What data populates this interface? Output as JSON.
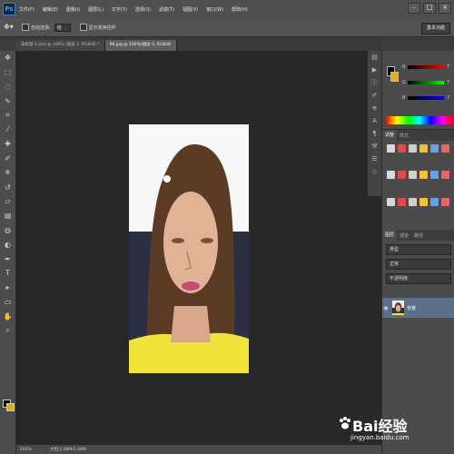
{
  "app": {
    "logo": "Ps"
  },
  "menu": [
    "文件(F)",
    "编辑(E)",
    "图像(I)",
    "图层(L)",
    "文字(Y)",
    "选择(S)",
    "滤镜(T)",
    "视图(V)",
    "窗口(W)",
    "帮助(H)"
  ],
  "window_controls": [
    "–",
    "□",
    "×"
  ],
  "options": {
    "auto_select_label": "自动选择:",
    "auto_select_value": "组",
    "transform_label": "显示变换控件"
  },
  "workspace_button": "基本功能",
  "tabs": [
    {
      "label": "未标题-1.psd @ 100% (图层 2, RGB/8) *",
      "active": false
    },
    {
      "label": "96.jpg @ 100%(图层 0, RGB/8)",
      "active": true
    }
  ],
  "tools": [
    "move-icon",
    "marquee-icon",
    "lasso-icon",
    "quick-select-icon",
    "crop-icon",
    "eyedropper-icon",
    "healing-icon",
    "brush-icon",
    "stamp-icon",
    "history-brush-icon",
    "eraser-icon",
    "gradient-icon",
    "blur-icon",
    "dodge-icon",
    "pen-icon",
    "type-icon",
    "path-select-icon",
    "shape-icon",
    "hand-icon",
    "zoom-icon"
  ],
  "tool_glyphs": [
    "✥",
    "⬚",
    "◌",
    "✎",
    "⌗",
    "⁄",
    "✚",
    "✐",
    "⎈",
    "↺",
    "▱",
    "▤",
    "◍",
    "◐",
    "✒",
    "T",
    "▸",
    "▭",
    "✋",
    "⌕"
  ],
  "colors": {
    "foreground": "#000000",
    "background": "#e8b000",
    "spectrum_start": "#ff0000"
  },
  "color_panel": {
    "r_label": "R",
    "g_label": "G",
    "b_label": "B",
    "r_value": "7",
    "g_value": "7",
    "b_value": "7"
  },
  "adjustments": {
    "tabs": [
      "调整",
      "样式"
    ]
  },
  "layers": {
    "tabs": [
      "图层",
      "通道",
      "路径"
    ],
    "kind_label": "类型",
    "blend_mode": "正常",
    "opacity_label": "不透明度:",
    "layer_name": "背景"
  },
  "status": {
    "zoom": "100%",
    "doc_info": "文档:2.08M/2.08M"
  },
  "watermark": {
    "brand": "Bai经验",
    "url": "jingyan.baidu.com"
  }
}
